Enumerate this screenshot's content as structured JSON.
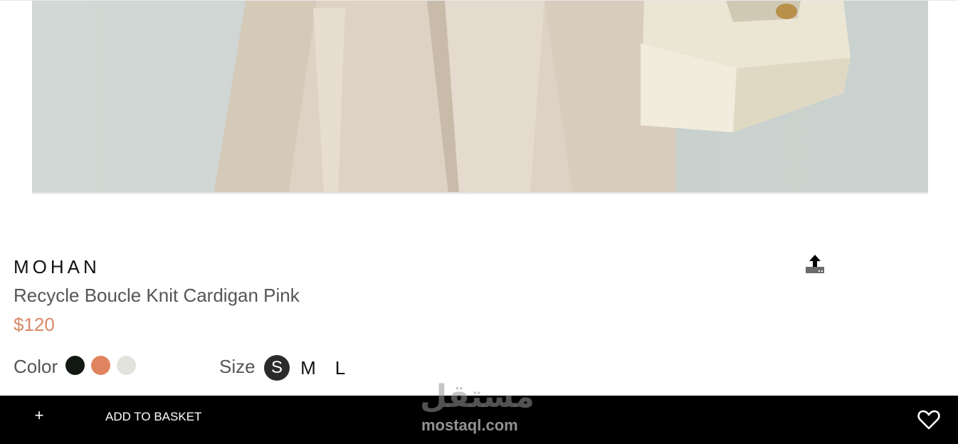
{
  "product": {
    "brand": "MOHAN",
    "name": "Recycle Boucle Knit Cardigan Pink",
    "price": "$120"
  },
  "options": {
    "color_label": "Color",
    "colors": [
      {
        "name": "black",
        "hex": "#121812"
      },
      {
        "name": "coral",
        "hex": "#e0845f"
      },
      {
        "name": "light-grey",
        "hex": "#e3e3de"
      }
    ],
    "size_label": "Size",
    "sizes": [
      {
        "label": "S",
        "selected": true
      },
      {
        "label": "M",
        "selected": false
      },
      {
        "label": "L",
        "selected": false
      }
    ]
  },
  "actions": {
    "plus_label": "+",
    "add_to_basket": "ADD TO BASKET",
    "share_icon": "upload-icon",
    "favorite_icon": "heart-icon"
  },
  "watermark": {
    "arabic": "مستقل",
    "latin": "mostaql.com"
  },
  "colors": {
    "price": "#d98a67",
    "bar": "#000000"
  }
}
